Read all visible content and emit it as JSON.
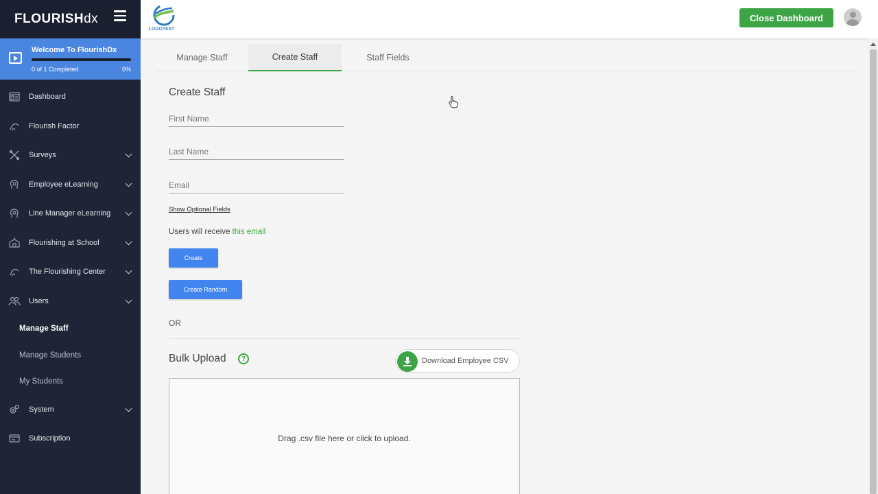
{
  "brand": {
    "name_main": "FLOURISH",
    "name_suffix": "dx"
  },
  "welcome": {
    "title": "Welcome To FlourishDx",
    "progress_text": "0 of 1 Completed",
    "percent": "0%",
    "progress_fraction": 0
  },
  "sidebar": {
    "items": [
      {
        "label": "Dashboard",
        "icon": "dashboard-icon",
        "has_chevron": false
      },
      {
        "label": "Flourish Factor",
        "icon": "flourish-factor-icon",
        "has_chevron": false
      },
      {
        "label": "Surveys",
        "icon": "surveys-icon",
        "has_chevron": true
      },
      {
        "label": "Employee eLearning",
        "icon": "employee-elearning-icon",
        "has_chevron": true
      },
      {
        "label": "Line Manager eLearning",
        "icon": "line-manager-elearning-icon",
        "has_chevron": true
      },
      {
        "label": "Flourishing at School",
        "icon": "school-icon",
        "has_chevron": true
      },
      {
        "label": "The Flourishing Center",
        "icon": "flourishing-center-icon",
        "has_chevron": true
      },
      {
        "label": "Users",
        "icon": "users-icon",
        "has_chevron": true
      }
    ],
    "users_sub": [
      {
        "label": "Manage Staff",
        "active": true
      },
      {
        "label": "Manage Students",
        "active": false
      },
      {
        "label": "My Students",
        "active": false
      }
    ],
    "bottom_items": [
      {
        "label": "System",
        "icon": "system-icon",
        "has_chevron": true
      },
      {
        "label": "Subscription",
        "icon": "subscription-icon",
        "has_chevron": false
      }
    ]
  },
  "topbar": {
    "logo_text": "LOGOTEXT",
    "close_label": "Close Dashboard"
  },
  "tabs": [
    {
      "label": "Manage Staff",
      "active": false
    },
    {
      "label": "Create Staff",
      "active": true
    },
    {
      "label": "Staff Fields",
      "active": false
    }
  ],
  "form": {
    "title": "Create Staff",
    "first_name_placeholder": "First Name",
    "last_name_placeholder": "Last Name",
    "email_placeholder": "Email",
    "first_name_value": "",
    "last_name_value": "",
    "email_value": "",
    "optional_link": "Show Optional Fields",
    "notice_prefix": "Users will receive ",
    "notice_link": "this email",
    "create_label": "Create",
    "create_random_label": "Create Random",
    "or_text": "OR"
  },
  "bulk": {
    "title": "Bulk Upload",
    "help_symbol": "?",
    "download_label": "Download Employee CSV",
    "drop_text": "Drag .csv file here or click to upload."
  },
  "colors": {
    "sidebar_bg": "#1f2536",
    "welcome_bg": "#4a86e0",
    "accent_green": "#3da546",
    "button_blue": "#4385f0"
  }
}
